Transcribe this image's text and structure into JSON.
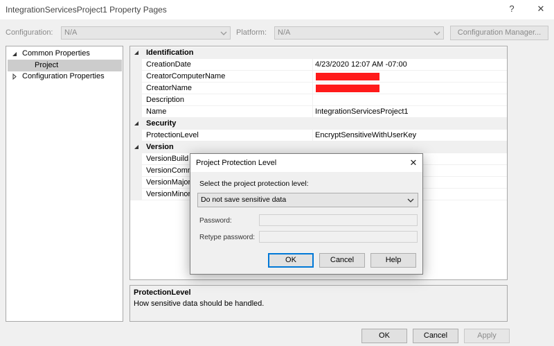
{
  "window": {
    "title": "IntegrationServicesProject1 Property Pages",
    "help_glyph": "?",
    "close_glyph": "✕"
  },
  "config_row": {
    "configuration_label": "Configuration:",
    "configuration_value": "N/A",
    "platform_label": "Platform:",
    "platform_value": "N/A",
    "manager_button": "Configuration Manager..."
  },
  "tree": {
    "items": [
      {
        "label": "Common Properties",
        "expanded": true
      },
      {
        "label": "Project",
        "selected": true
      },
      {
        "label": "Configuration Properties",
        "expanded": false
      }
    ]
  },
  "grid": {
    "categories": {
      "identification": "Identification",
      "security": "Security",
      "version": "Version"
    },
    "rows": {
      "creation_date": {
        "name": "CreationDate",
        "value": "4/23/2020 12:07 AM -07:00"
      },
      "creator_computer": {
        "name": "CreatorComputerName",
        "value": ""
      },
      "creator_name": {
        "name": "CreatorName",
        "value": ""
      },
      "description": {
        "name": "Description",
        "value": ""
      },
      "name": {
        "name": "Name",
        "value": "IntegrationServicesProject1"
      },
      "protection_level": {
        "name": "ProtectionLevel",
        "value": "EncryptSensitiveWithUserKey"
      },
      "version_build": {
        "name": "VersionBuild"
      },
      "version_comments": {
        "name": "VersionComm"
      },
      "version_major": {
        "name": "VersionMajor"
      },
      "version_minor": {
        "name": "VersionMinor"
      }
    }
  },
  "description_pane": {
    "title": "ProtectionLevel",
    "text": "How sensitive data should be handled."
  },
  "footer": {
    "ok": "OK",
    "cancel": "Cancel",
    "apply": "Apply"
  },
  "modal": {
    "title": "Project Protection Level",
    "close_glyph": "✕",
    "prompt": "Select the project protection level:",
    "selected_level": "Do not save sensitive data",
    "password_label": "Password:",
    "retype_label": "Retype password:",
    "ok": "OK",
    "cancel": "Cancel",
    "help": "Help"
  },
  "colors": {
    "redaction": "#ff1a1a",
    "selection": "#cccccc",
    "accent_border": "#0078d7"
  }
}
